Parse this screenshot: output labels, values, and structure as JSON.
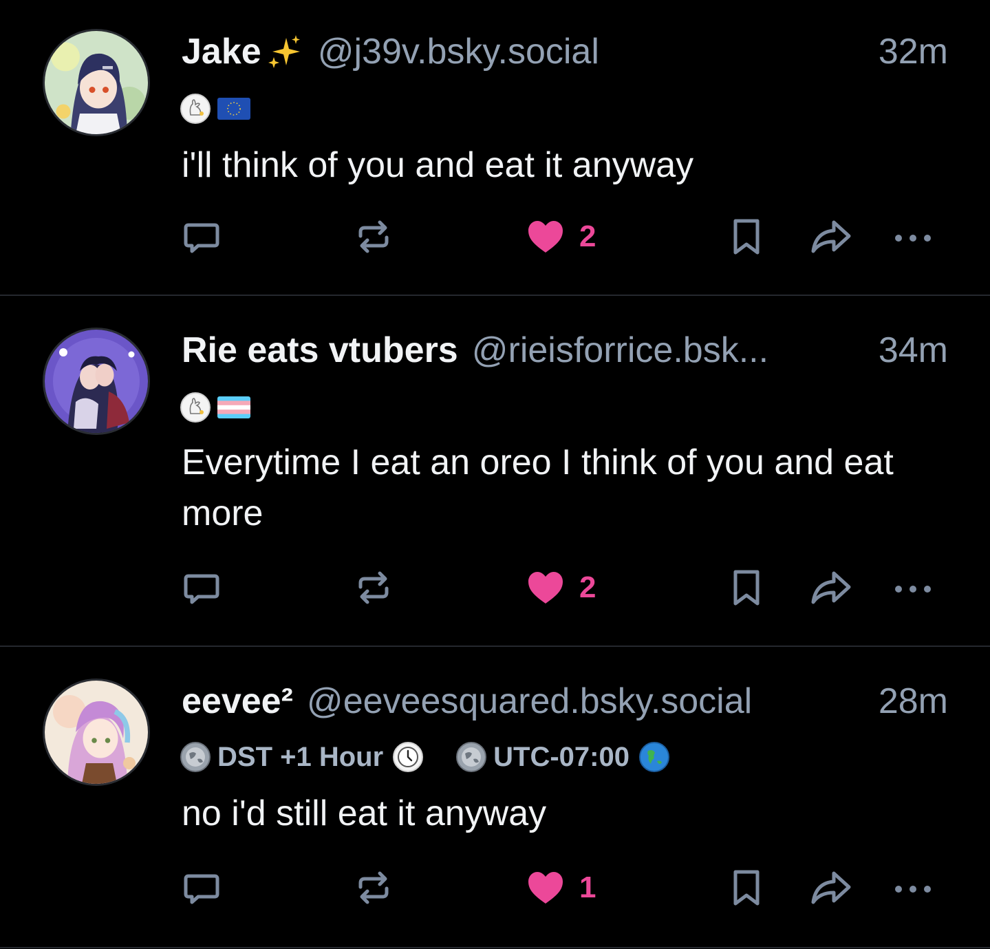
{
  "colors": {
    "background": "#000000",
    "divider": "#25282e",
    "text": "#f1f3f5",
    "muted": "#93a1b3",
    "icon": "#7d8ba0",
    "like": "#ec4899"
  },
  "posts": [
    {
      "display_name": "Jake",
      "name_emoji": "sparkles",
      "handle": "@j39v.bsky.social",
      "time": "32m",
      "badges": [
        {
          "type": "icon",
          "icon": "bunny-badge-icon"
        },
        {
          "type": "icon",
          "icon": "eu-flag-icon"
        }
      ],
      "text": "i'll think of you and eat it anyway",
      "likes": "2",
      "liked": true
    },
    {
      "display_name": "Rie eats vtubers",
      "handle": "@rieisforrice.bsk...",
      "time": "34m",
      "badges": [
        {
          "type": "icon",
          "icon": "bunny-badge-icon"
        },
        {
          "type": "icon",
          "icon": "trans-flag-icon"
        }
      ],
      "text": "Everytime I eat an oreo I think of you and eat more",
      "likes": "2",
      "liked": true
    },
    {
      "display_name": "eevee²",
      "handle": "@eeveesquared.bsky.social",
      "time": "28m",
      "badges": [
        {
          "type": "label",
          "icon": "earth-badge-icon",
          "text": "DST +1 Hour",
          "trailing_icon": "clock-icon"
        },
        {
          "type": "label",
          "icon": "earth-badge-icon",
          "text": "UTC-07:00",
          "trailing_icon": "globe-americas-icon"
        }
      ],
      "text": "no i'd still eat it anyway",
      "likes": "1",
      "liked": true
    }
  ]
}
